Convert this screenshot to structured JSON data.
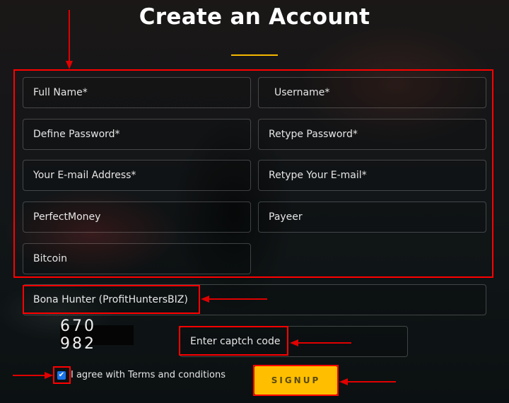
{
  "page": {
    "title": "Create an Account",
    "accent_color": "#f5b800",
    "annotation_color": "#ff0000"
  },
  "form": {
    "fields": {
      "full_name": {
        "placeholder": "Full Name*",
        "value": ""
      },
      "username": {
        "placeholder": "Username*",
        "value": ""
      },
      "define_password": {
        "placeholder": "Define Password*",
        "value": ""
      },
      "retype_password": {
        "placeholder": "Retype Password*",
        "value": ""
      },
      "email": {
        "placeholder": "Your E-mail Address*",
        "value": ""
      },
      "retype_email": {
        "placeholder": "Retype Your E-mail*",
        "value": ""
      },
      "perfectmoney": {
        "placeholder": "PerfectMoney",
        "value": ""
      },
      "payeer": {
        "placeholder": "Payeer",
        "value": ""
      },
      "bitcoin": {
        "placeholder": "Bitcoin",
        "value": ""
      },
      "upline": {
        "value": "Bona Hunter (ProfitHuntersBIZ)"
      },
      "captcha_input": {
        "placeholder": "Enter captch code",
        "value": ""
      }
    },
    "captcha_image_text": "670 982",
    "terms": {
      "checked": true,
      "check_glyph": "✔",
      "label": "I agree with Terms and conditions"
    },
    "signup_button": {
      "label": "SIGNUP",
      "color": "#ffbf00"
    }
  }
}
